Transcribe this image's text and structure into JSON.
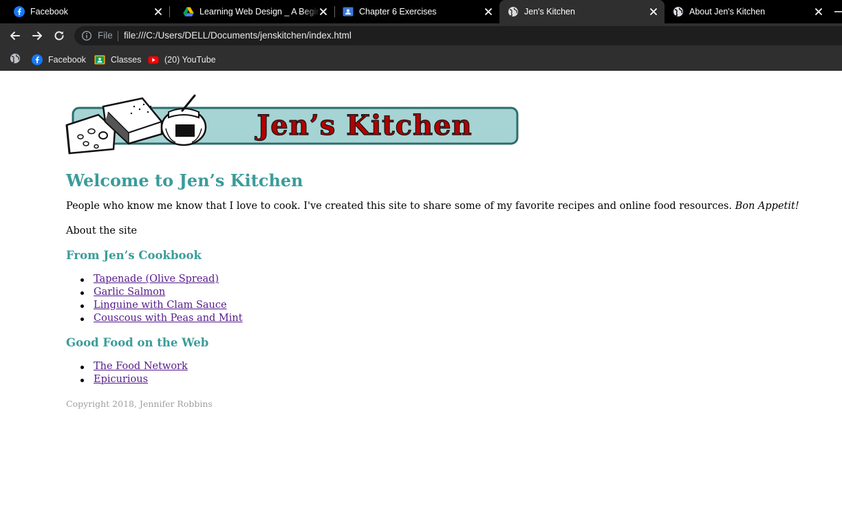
{
  "browser": {
    "tabs": [
      {
        "title": "Facebook",
        "icon": "facebook-icon"
      },
      {
        "title": "Learning Web Design _ A Beginne",
        "icon": "google-drive-icon"
      },
      {
        "title": "Chapter 6 Exercises",
        "icon": "google-classroom-icon"
      },
      {
        "title": "Jen's Kitchen",
        "icon": "globe-icon",
        "active": true
      },
      {
        "title": "About Jen's Kitchen",
        "icon": "globe-icon"
      }
    ],
    "address_bar": {
      "scheme_label": "File",
      "url": "file:///C:/Users/DELL/Documents/jenskitchen/index.html"
    },
    "bookmarks": [
      {
        "label": "Facebook",
        "icon": "facebook-icon"
      },
      {
        "label": "Classes",
        "icon": "google-classroom-icon"
      },
      {
        "label": "(20) YouTube",
        "icon": "youtube-icon"
      }
    ],
    "colors": {
      "tabstrip": "#000000",
      "toolbar": "#2f2f2f",
      "omnibox": "#1e1e1e"
    }
  },
  "page": {
    "logo": {
      "text": "Jen’s Kitchen",
      "text_color": "#b30000",
      "panel_color": "#a6d3d3",
      "border_color": "#2b6e6e"
    },
    "heading": "Welcome to Jen’s Kitchen",
    "intro_text": "People who know me know that I love to cook. I've created this site to share some of my favorite recipes and online food resources.",
    "intro_emphasis": "Bon Appetit!",
    "about_text": "About the site",
    "cookbook": {
      "heading": "From Jen’s Cookbook",
      "items": [
        "Tapenade (Olive Spread)",
        "Garlic Salmon",
        "Linguine with Clam Sauce",
        "Couscous with Peas and Mint"
      ]
    },
    "web": {
      "heading": "Good Food on the Web",
      "items": [
        "The Food Network",
        "Epicurious"
      ]
    },
    "copyright": "Copyright 2018, Jennifer Robbins",
    "colors": {
      "heading": "#3a9c9a",
      "link_visited": "#551a8b",
      "copyright": "#a0a0a0"
    }
  }
}
